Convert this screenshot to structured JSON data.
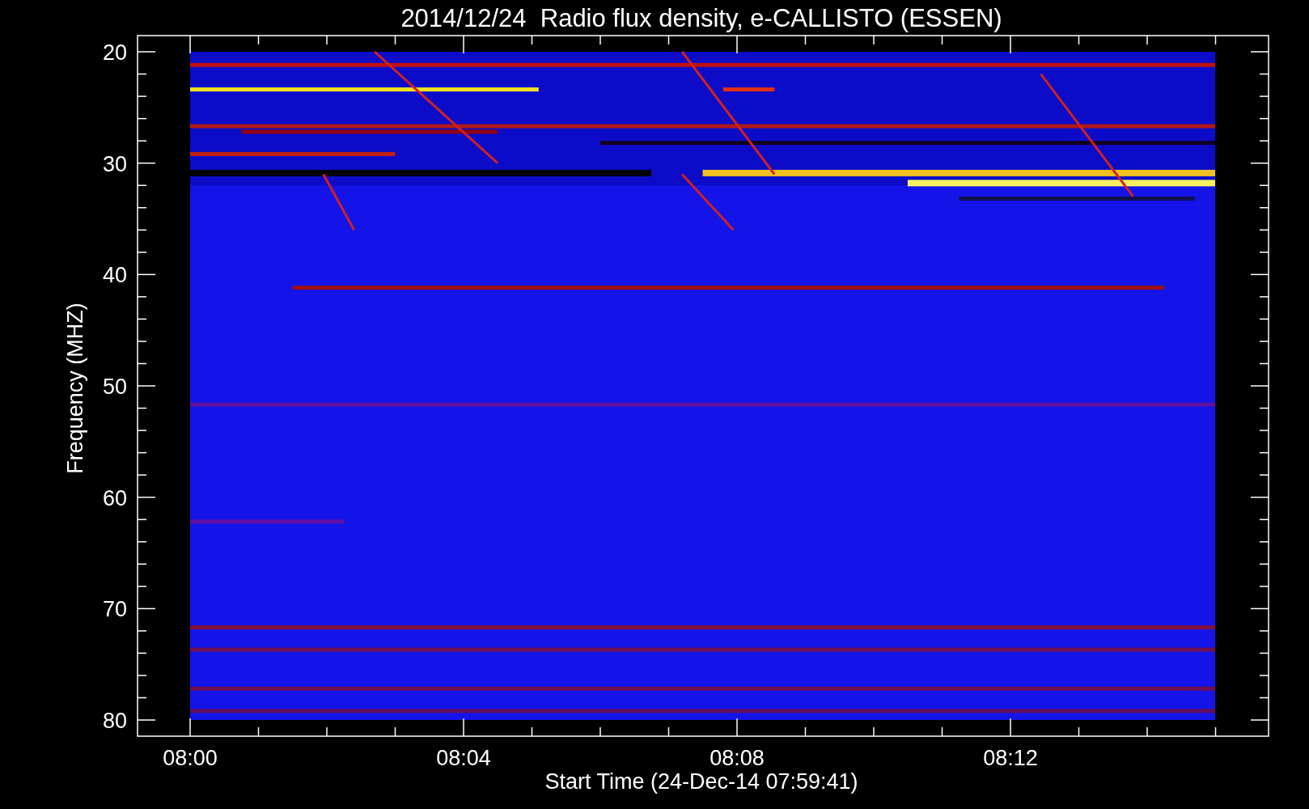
{
  "title": "2014/12/24  Radio flux density, e-CALLISTO (ESSEN)",
  "y_axis": {
    "label": "Frequency (MHZ)",
    "ticks": [
      "20",
      "30",
      "40",
      "50",
      "60",
      "70",
      "80"
    ]
  },
  "x_axis": {
    "label": "Start Time (24-Dec-14 07:59:41)",
    "ticks": [
      "08:00",
      "08:04",
      "08:08",
      "08:12"
    ]
  }
}
